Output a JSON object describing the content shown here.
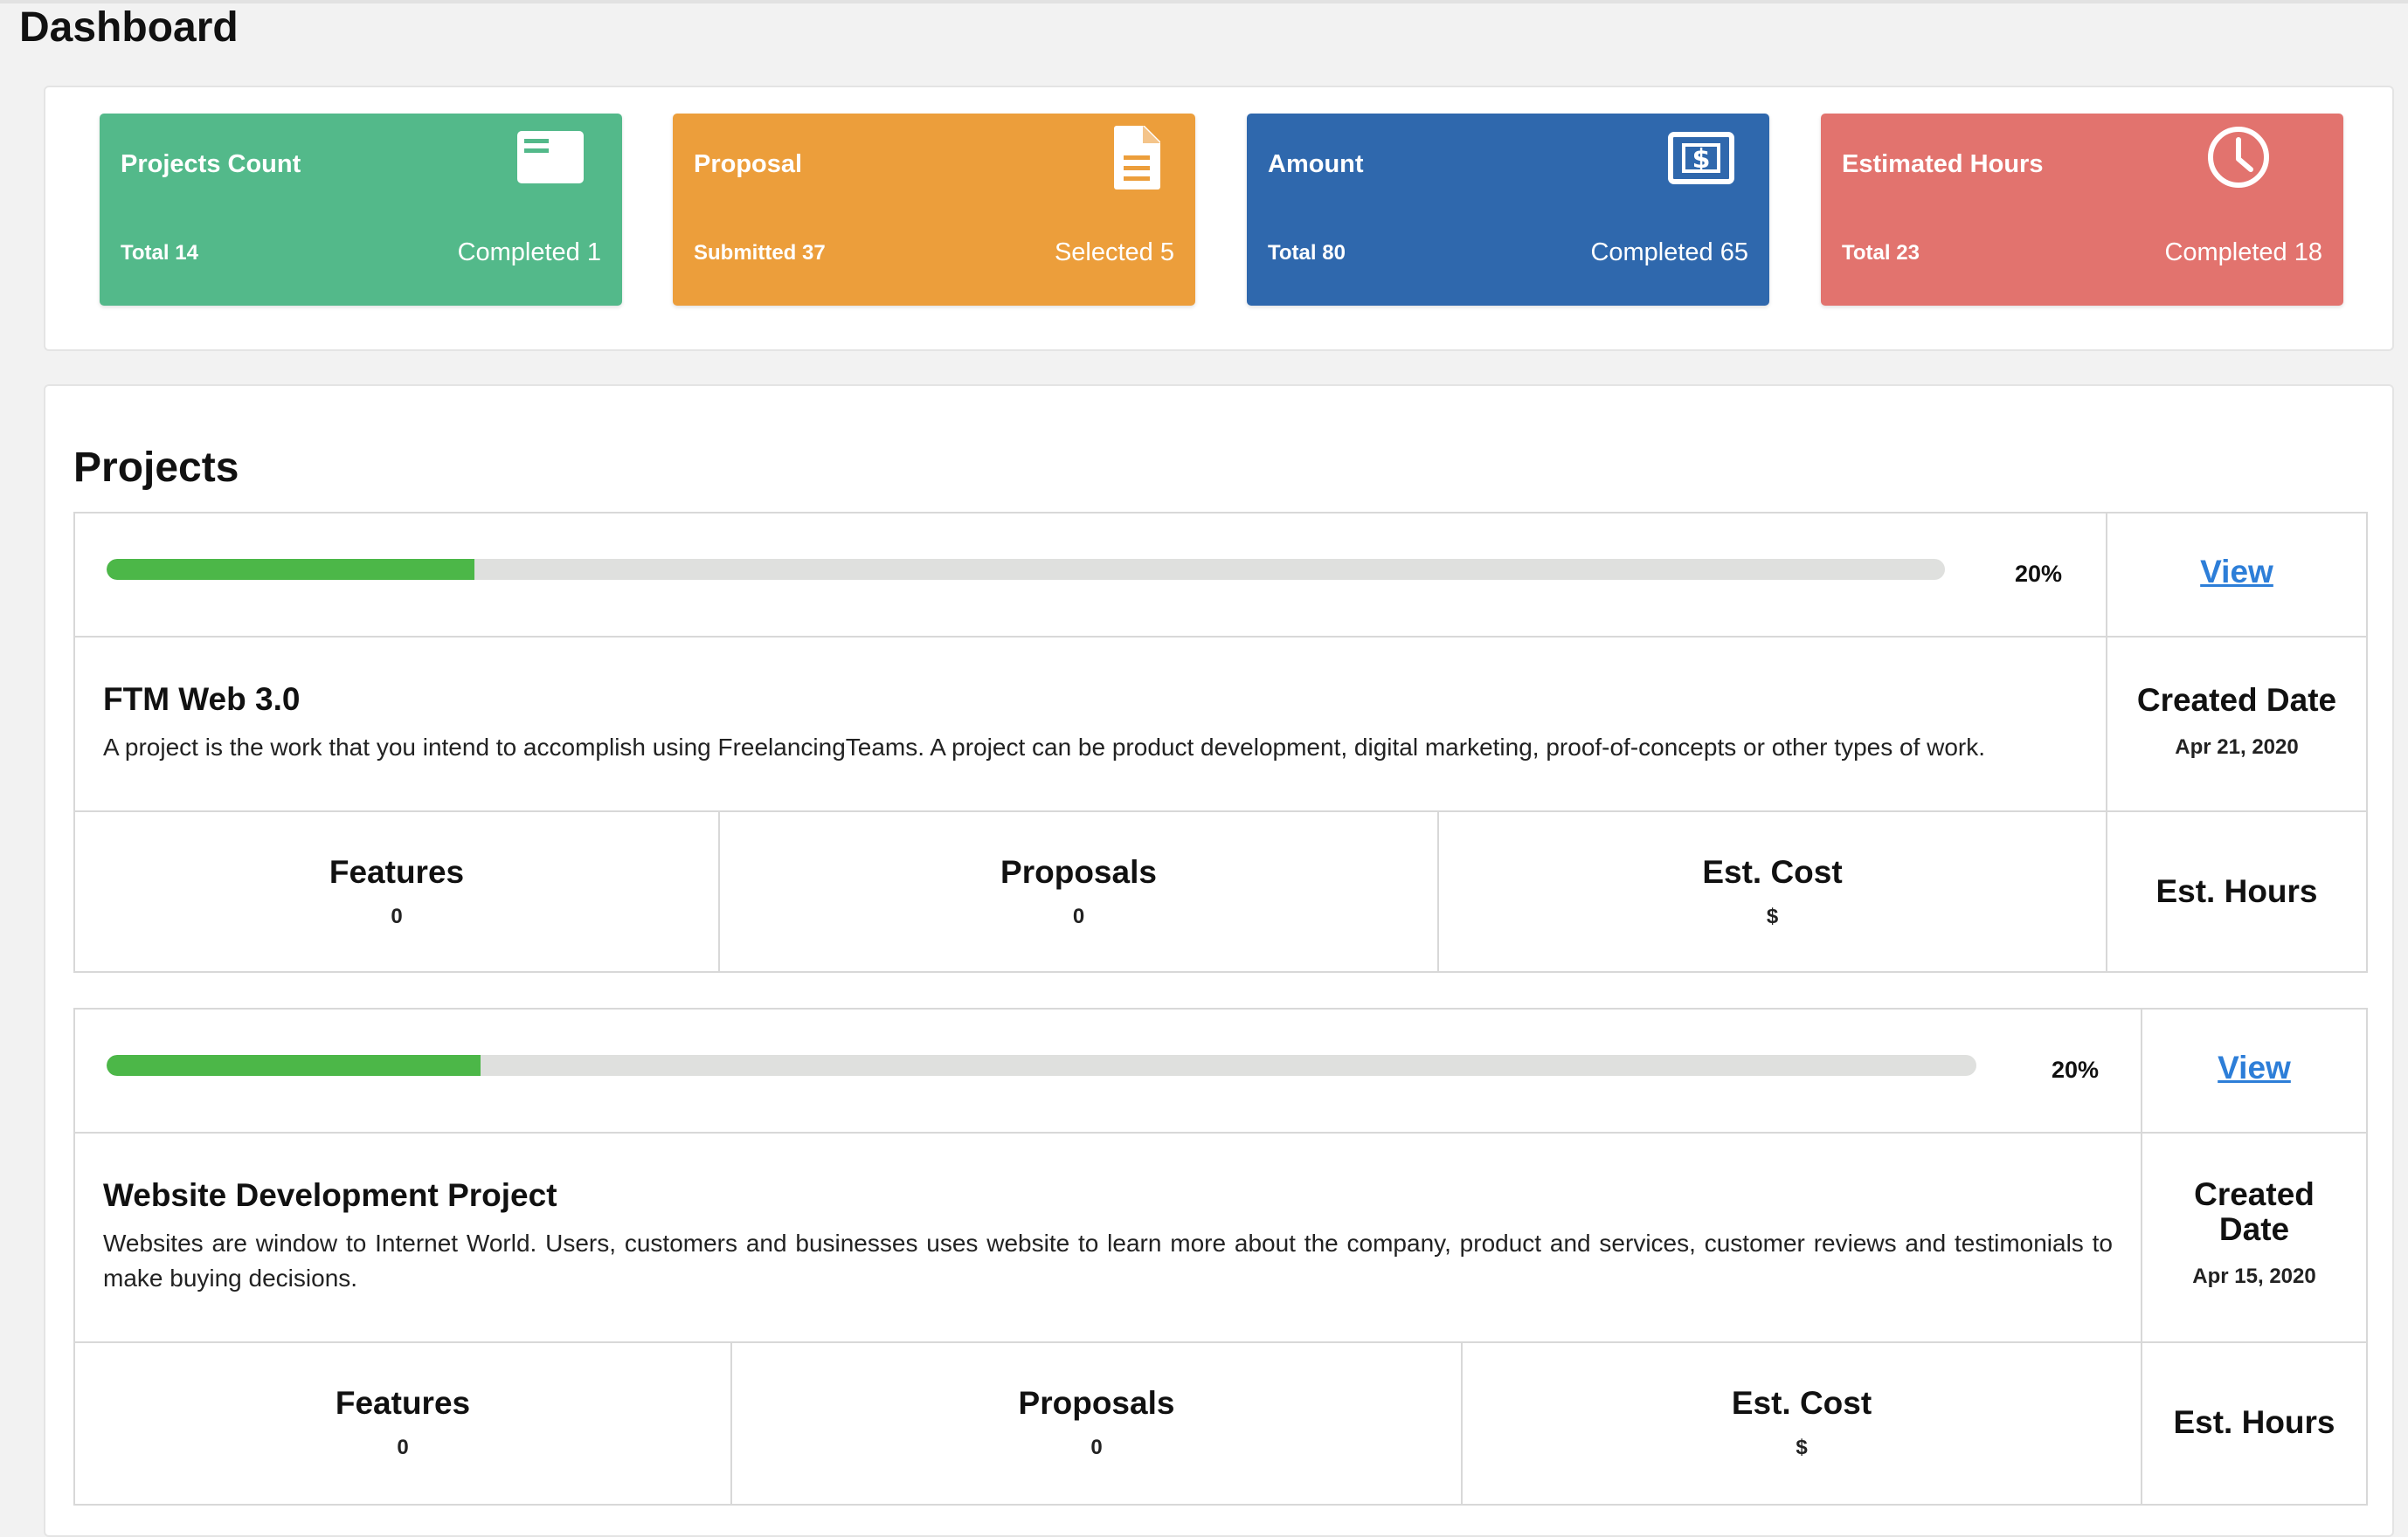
{
  "page": {
    "title": "Dashboard"
  },
  "stats": [
    {
      "title": "Projects Count",
      "left_text": "Total 14",
      "right_text": "Completed 1",
      "color": "#53b98a",
      "icon": "card-icon"
    },
    {
      "title": "Proposal",
      "left_text": "Submitted 37",
      "right_text": "Selected 5",
      "color": "#ec9e3b",
      "icon": "document-icon"
    },
    {
      "title": "Amount",
      "left_text": "Total 80",
      "right_text": "Completed 65",
      "color": "#2f68ad",
      "icon": "dollar-bill-icon"
    },
    {
      "title": "Estimated Hours",
      "left_text": "Total 23",
      "right_text": "Completed 18",
      "color": "#e2736e",
      "icon": "clock-icon"
    }
  ],
  "projects_section": {
    "heading": "Projects",
    "items": [
      {
        "progress": 20,
        "progress_label": "20%",
        "view_label": "View",
        "name": "FTM Web 3.0",
        "description": "A project is the work that you intend to accomplish using FreelancingTeams. A project can be product development, digital marketing, proof-of-concepts or other types of work.",
        "created_label": "Created Date",
        "created_date": "Apr 21, 2020",
        "features_label": "Features",
        "features_value": "0",
        "proposals_label": "Proposals",
        "proposals_value": "0",
        "cost_label": "Est. Cost",
        "cost_value": "$",
        "hours_label": "Est. Hours"
      },
      {
        "progress": 20,
        "progress_label": "20%",
        "view_label": "View",
        "name": "Website Development Project",
        "description": "Websites are window to Internet World. Users, customers and businesses uses website to learn more about the company, product and services, customer reviews and testimonials to make buying decisions.",
        "created_label_line1": "Created",
        "created_label_line2": "Date",
        "created_date": "Apr 15, 2020",
        "features_label": "Features",
        "features_value": "0",
        "proposals_label": "Proposals",
        "proposals_value": "0",
        "cost_label": "Est. Cost",
        "cost_value": "$",
        "hours_label": "Est. Hours"
      }
    ]
  },
  "colors": {
    "progress_fill": "#4cb748",
    "progress_track": "#dfe0de",
    "link": "#2d7ed8"
  }
}
